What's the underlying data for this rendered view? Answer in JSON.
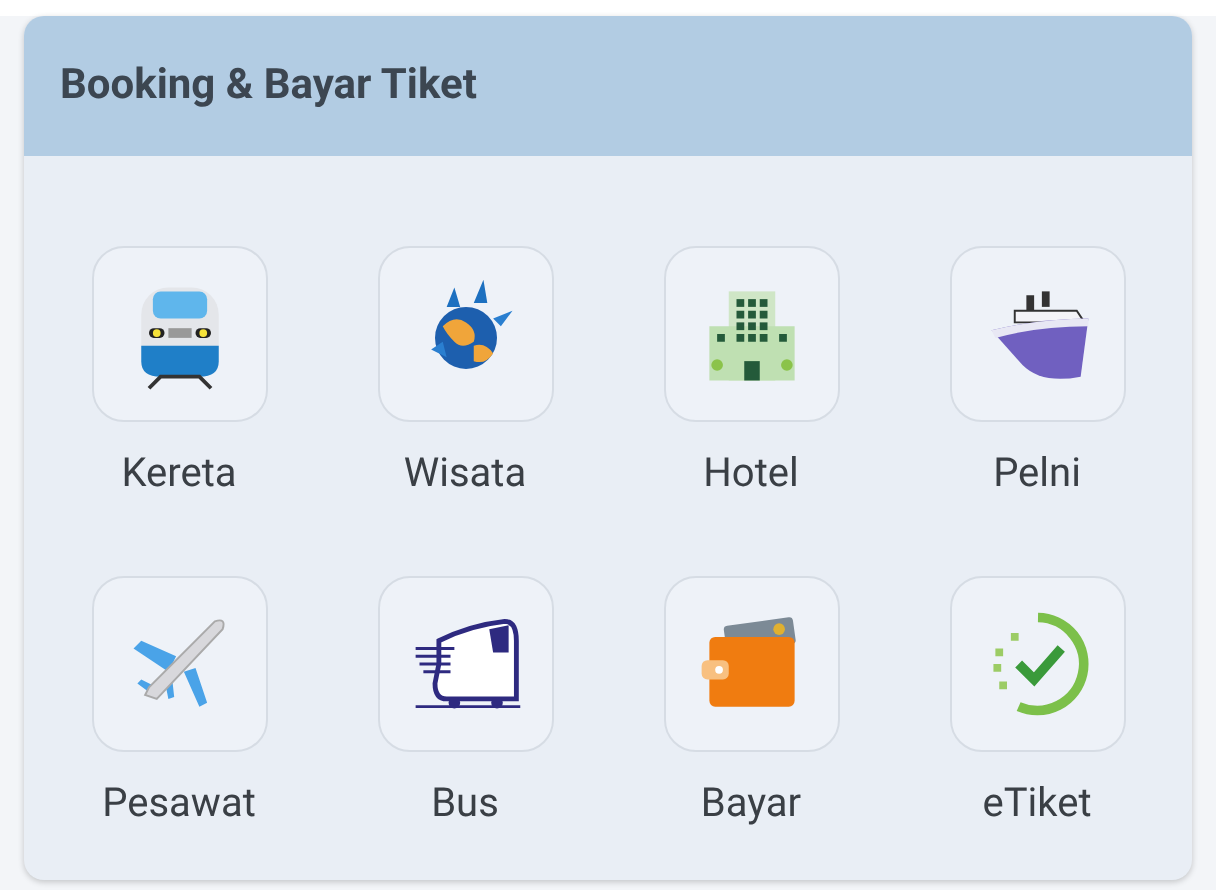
{
  "card": {
    "title": "Booking & Bayar Tiket"
  },
  "items": [
    {
      "kind": "train",
      "label": "Kereta"
    },
    {
      "kind": "globe",
      "label": "Wisata"
    },
    {
      "kind": "hotel",
      "label": "Hotel"
    },
    {
      "kind": "ship",
      "label": "Pelni"
    },
    {
      "kind": "plane",
      "label": "Pesawat"
    },
    {
      "kind": "bus",
      "label": "Bus"
    },
    {
      "kind": "wallet",
      "label": "Bayar"
    },
    {
      "kind": "ticket",
      "label": "eTiket"
    }
  ]
}
